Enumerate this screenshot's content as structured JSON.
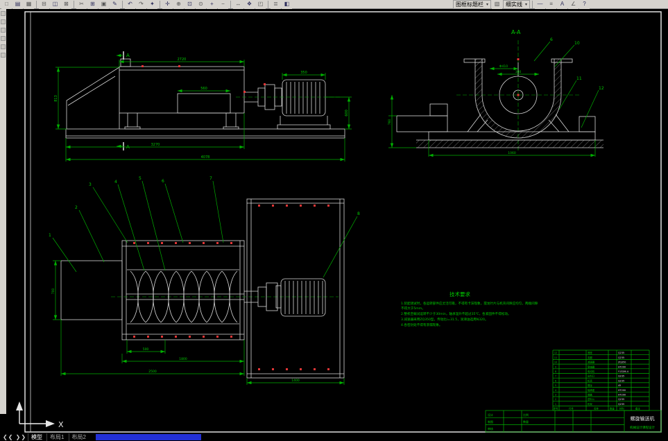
{
  "toolbar": {
    "chevron": "▾",
    "layer_combo": "图框标题栏",
    "linetype_combo": "细实线",
    "icons": [
      {
        "name": "new",
        "glyph": "□"
      },
      {
        "name": "open",
        "glyph": "▤"
      },
      {
        "name": "save",
        "glyph": "▦"
      },
      {
        "name": "plot",
        "glyph": "⊟"
      },
      {
        "name": "print-preview",
        "glyph": "◫"
      },
      {
        "name": "publish",
        "glyph": "⊠"
      },
      {
        "name": "cut",
        "glyph": "✂"
      },
      {
        "name": "copy",
        "glyph": "⊞"
      },
      {
        "name": "paste",
        "glyph": "▣"
      },
      {
        "name": "match-properties",
        "glyph": "✎"
      },
      {
        "name": "undo",
        "glyph": "↶"
      },
      {
        "name": "redo",
        "glyph": "↷"
      },
      {
        "name": "hyperlink",
        "glyph": "✦"
      },
      {
        "name": "pan",
        "glyph": "✛"
      },
      {
        "name": "zoom-realtime",
        "glyph": "⊕"
      },
      {
        "name": "zoom-window",
        "glyph": "⊡"
      },
      {
        "name": "zoom-previous",
        "glyph": "⊙"
      },
      {
        "name": "zoom-in",
        "glyph": "+"
      },
      {
        "name": "zoom-out",
        "glyph": "−"
      },
      {
        "name": "distance",
        "glyph": "↔"
      },
      {
        "name": "properties",
        "glyph": "❖"
      },
      {
        "name": "designcenter",
        "glyph": "◰"
      },
      {
        "name": "layers",
        "glyph": "≣"
      },
      {
        "name": "layer-previous",
        "glyph": "◧"
      },
      {
        "name": "color-control",
        "glyph": "▧"
      },
      {
        "name": "linetype-manager",
        "glyph": "—"
      },
      {
        "name": "lineweight",
        "glyph": "≡"
      },
      {
        "name": "text-style",
        "glyph": "A"
      },
      {
        "name": "dim-style",
        "glyph": "∠"
      },
      {
        "name": "help",
        "glyph": "?"
      }
    ]
  },
  "drawing": {
    "section_label": "A-A",
    "section_mark": "A",
    "balloons": {
      "plan": [
        "1",
        "2",
        "3",
        "4",
        "5",
        "6",
        "7",
        "8"
      ],
      "section": [
        "6",
        "10",
        "11",
        "12"
      ]
    },
    "dims": {
      "ds1": "2720",
      "ds2": "560",
      "ds3": "813",
      "ds4": "4078",
      "ds5": "3270",
      "ds6": "600",
      "ds7": "350",
      "dc1": "Φ410",
      "dc2": "380",
      "dc3": "760",
      "dc4": "1060",
      "dp1": "500",
      "dp2": "1800",
      "dp3": "2500",
      "dp4": "1400",
      "dp5": "700"
    },
    "tech": {
      "title": "技术要求",
      "lines": [
        "1.装配调试时，各运转部件应灵活可靠，不得有卡滞现象，搅龙叶片与机壳间隙应均匀，两端间隙",
        "不得大于5mm。",
        "2.整机空载试运转不少于30min，轴承温升不超过35℃，各紧固件不得松动。",
        "3.减速器采用ZQ350型，传动比i=31.5，润滑油选用N320。",
        "4.各密封处不得有渗漏现象。"
      ]
    },
    "parts": {
      "headers": [
        "序号",
        "代号",
        "名称",
        "数量",
        "材料",
        "备注"
      ],
      "rows": [
        {
          "no": "12",
          "code": "SLJ-12",
          "name": "底座",
          "qty": "1",
          "mat": "Q235"
        },
        {
          "no": "11",
          "code": "SLJ-11",
          "name": "支腿",
          "qty": "2",
          "mat": "Q235"
        },
        {
          "no": "10",
          "code": "SLJ-10",
          "name": "减速器",
          "qty": "1",
          "mat": "ZQ350"
        },
        {
          "no": "9",
          "code": "SLJ-09",
          "name": "联轴器",
          "qty": "2",
          "mat": "HT200"
        },
        {
          "no": "8",
          "code": "SLJ-08",
          "name": "电动机",
          "qty": "1",
          "mat": "Y132M-4"
        },
        {
          "no": "7",
          "code": "SLJ-07",
          "name": "出料口",
          "qty": "1",
          "mat": "Q235"
        },
        {
          "no": "6",
          "code": "SLJ-06",
          "name": "机壳",
          "qty": "1",
          "mat": "Q235"
        },
        {
          "no": "5",
          "code": "SLJ-05",
          "name": "搅龙",
          "qty": "1",
          "mat": "45"
        },
        {
          "no": "4",
          "code": "SLJ-04",
          "name": "轴承座",
          "qty": "2",
          "mat": "HT200"
        },
        {
          "no": "3",
          "code": "SLJ-03",
          "name": "端盖",
          "qty": "2",
          "mat": "HT200"
        },
        {
          "no": "2",
          "code": "SLJ-02",
          "name": "进料斗",
          "qty": "1",
          "mat": "Q235"
        },
        {
          "no": "1",
          "code": "SLJ-01",
          "name": "机架",
          "qty": "1",
          "mat": "Q235"
        }
      ]
    },
    "titleblock": {
      "name": "螺旋输送机",
      "org": "机械设计课程设计",
      "f_design": "设计",
      "f_draft": "制图",
      "f_check": "审核",
      "f_scale": "比例",
      "f_qty": "数量"
    }
  },
  "ucs": {
    "x": "X"
  },
  "statusbar": {
    "nav": "❮❮ ❯❯",
    "tabs": [
      "模型",
      "布局1",
      "布局2"
    ]
  }
}
